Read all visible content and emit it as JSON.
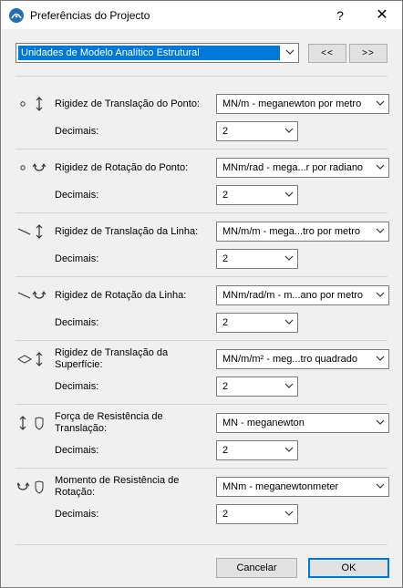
{
  "window": {
    "title": "Preferências do Projecto",
    "help": "?",
    "close": "✕"
  },
  "top": {
    "selected": "Unidades de Modelo Analítico Estrutural",
    "prev": "<<",
    "next": ">>"
  },
  "rows": [
    {
      "label": "Rigidez de Translação do Ponto:",
      "unit": "MN/m - meganewton por metro",
      "decimals_label": "Decimais:",
      "decimals": "2",
      "icon": "point-translation-icon"
    },
    {
      "label": "Rigidez de Rotação do Ponto:",
      "unit": "MNm/rad - mega...r por radiano",
      "decimals_label": "Decimais:",
      "decimals": "2",
      "icon": "point-rotation-icon"
    },
    {
      "label": "Rigidez de Translação da Linha:",
      "unit": "MN/m/m - mega...tro por metro",
      "decimals_label": "Decimais:",
      "decimals": "2",
      "icon": "line-translation-icon"
    },
    {
      "label": "Rigidez de Rotação da Linha:",
      "unit": "MNm/rad/m - m...ano por metro",
      "decimals_label": "Decimais:",
      "decimals": "2",
      "icon": "line-rotation-icon"
    },
    {
      "label": "Rigidez de Translação da Superfície:",
      "unit": "MN/m/m² - meg...tro quadrado",
      "decimals_label": "Decimais:",
      "decimals": "2",
      "icon": "surface-translation-icon"
    },
    {
      "label": "Força de Resistência de Translação:",
      "unit": "MN - meganewton",
      "decimals_label": "Decimais:",
      "decimals": "2",
      "icon": "translation-resistance-icon"
    },
    {
      "label": "Momento de Resistência de Rotação:",
      "unit": "MNm - meganewtonmeter",
      "decimals_label": "Decimais:",
      "decimals": "2",
      "icon": "rotation-resistance-icon"
    }
  ],
  "footer": {
    "cancel": "Cancelar",
    "ok": "OK"
  }
}
